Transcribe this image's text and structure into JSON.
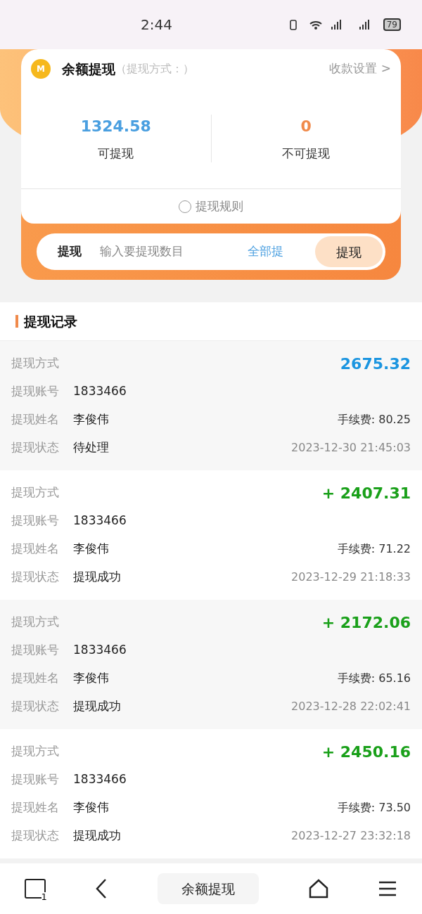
{
  "status_bar": {
    "time": "2:44",
    "battery": "79"
  },
  "balance_card": {
    "coin": "M",
    "title": "余额提现",
    "method": "（提现方式：）",
    "settings_link": "收款设置 >",
    "stats": [
      {
        "value": "1324.58",
        "label": "可提现",
        "kind": "available"
      },
      {
        "value": "0",
        "label": "不可提现",
        "kind": "unavailable"
      }
    ],
    "rules": "提现规则",
    "withdraw": {
      "label": "提现",
      "placeholder": "输入要提现数目",
      "all_link": "全部提",
      "button": "提现"
    }
  },
  "records_title": "提现记录",
  "records": [
    {
      "method_label": "提现方式",
      "amount": "2675.32",
      "kind": "pending",
      "account_label": "提现账号",
      "account": "1833466",
      "name_label": "提现姓名",
      "name": "李俊伟",
      "fee": "手续费: 80.25",
      "state_label": "提现状态",
      "state": "待处理",
      "time": "2023-12-30 21:45:03"
    },
    {
      "method_label": "提现方式",
      "amount": "+ 2407.31",
      "kind": "success",
      "account_label": "提现账号",
      "account": "1833466",
      "name_label": "提现姓名",
      "name": "李俊伟",
      "fee": "手续费: 71.22",
      "state_label": "提现状态",
      "state": "提现成功",
      "time": "2023-12-29 21:18:33"
    },
    {
      "method_label": "提现方式",
      "amount": "+ 2172.06",
      "kind": "success",
      "account_label": "提现账号",
      "account": "1833466",
      "name_label": "提现姓名",
      "name": "李俊伟",
      "fee": "手续费: 65.16",
      "state_label": "提现状态",
      "state": "提现成功",
      "time": "2023-12-28 22:02:41"
    },
    {
      "method_label": "提现方式",
      "amount": "+ 2450.16",
      "kind": "success",
      "account_label": "提现账号",
      "account": "1833466",
      "name_label": "提现姓名",
      "name": "李俊伟",
      "fee": "手续费: 73.50",
      "state_label": "提现状态",
      "state": "提现成功",
      "time": "2023-12-27 23:32:18"
    }
  ],
  "bottom_bar": {
    "tabs_count": "1",
    "title": "余额提现"
  }
}
